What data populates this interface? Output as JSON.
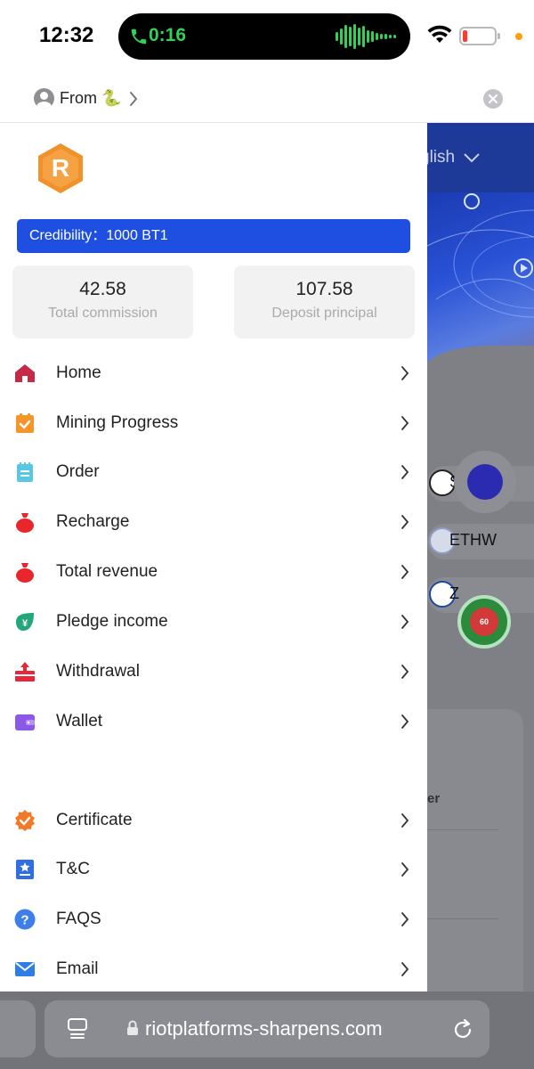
{
  "status_bar": {
    "time": "12:32",
    "call_duration": "0:16",
    "call_color": "#31d158",
    "icons": [
      "phone-icon",
      "waveform-icon",
      "wifi-icon",
      "battery-icon"
    ]
  },
  "from_bar": {
    "label": "From 🐍",
    "icons": [
      "user-icon",
      "chevron-right-icon",
      "close-icon"
    ]
  },
  "drawer": {
    "logo_letter": "R",
    "brand_color": "#f0912c",
    "credibility": "Credibility：1000 BT1",
    "credibility_color": "#1f4fe0",
    "stats": [
      {
        "value": "42.58",
        "label": "Total commission"
      },
      {
        "value": "107.58",
        "label": "Deposit principal"
      }
    ],
    "menu": [
      {
        "label": "Home",
        "icon": "home-icon"
      },
      {
        "label": "Mining Progress",
        "icon": "clipboard-check-icon"
      },
      {
        "label": "Order",
        "icon": "notepad-icon"
      },
      {
        "label": "Recharge",
        "icon": "money-bag-icon"
      },
      {
        "label": "Total revenue",
        "icon": "money-bag-icon"
      },
      {
        "label": "Pledge income",
        "icon": "leaf-coin-icon"
      },
      {
        "label": "Withdrawal",
        "icon": "upload-box-icon"
      },
      {
        "label": "Wallet",
        "icon": "wallet-icon"
      },
      {
        "label": "Certificate",
        "icon": "certificate-badge-icon"
      },
      {
        "label": "T&C",
        "icon": "document-star-icon"
      },
      {
        "label": "FAQS",
        "icon": "question-icon"
      },
      {
        "label": "Email",
        "icon": "mail-icon"
      }
    ]
  },
  "background_app": {
    "language": "glish",
    "coins": [
      "SF",
      "ETHW",
      "Z"
    ],
    "card_text": "er",
    "timer_text": "60"
  },
  "browser": {
    "url": "riotplatforms-sharpens.com",
    "icons": [
      "reader-icon",
      "lock-icon",
      "reload-icon"
    ]
  }
}
